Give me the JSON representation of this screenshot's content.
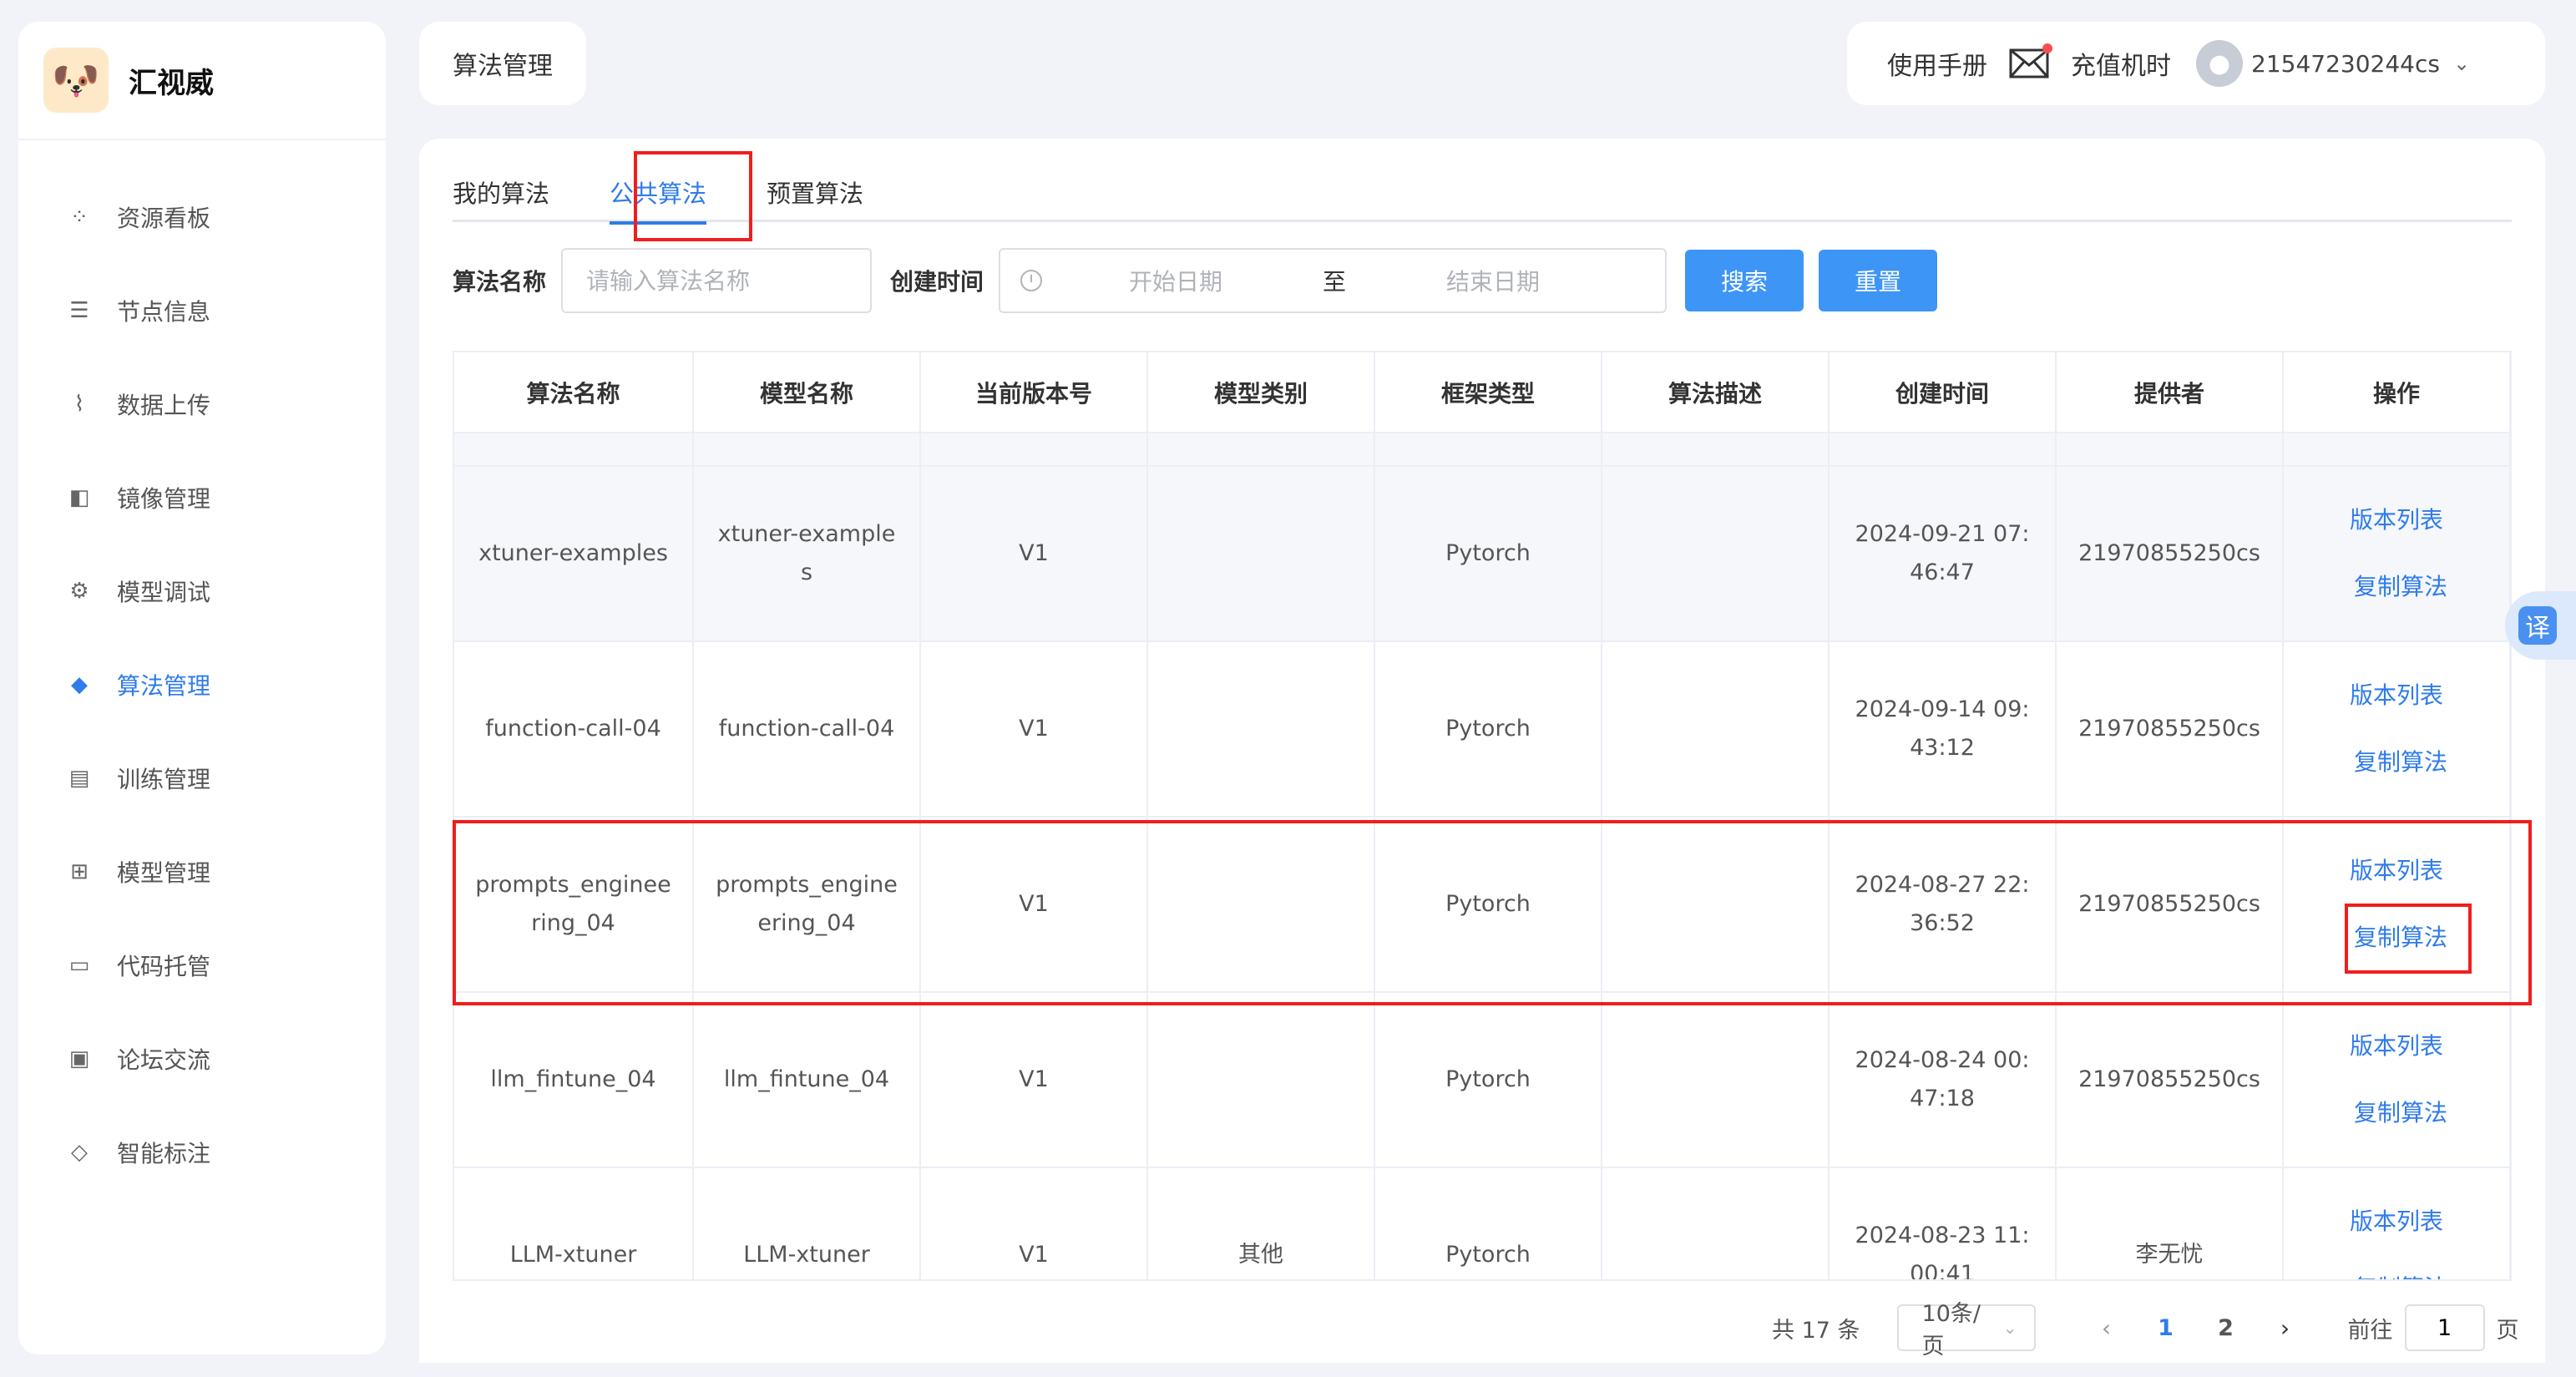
{
  "brand": {
    "name": "汇视威",
    "logo_icon": "dog-logo"
  },
  "sidebar": {
    "items": [
      {
        "label": "资源看板",
        "icon": "dashboard-icon"
      },
      {
        "label": "节点信息",
        "icon": "sliders-icon"
      },
      {
        "label": "数据上传",
        "icon": "chart-icon"
      },
      {
        "label": "镜像管理",
        "icon": "mirror-icon"
      },
      {
        "label": "模型调试",
        "icon": "gear-icon"
      },
      {
        "label": "算法管理",
        "icon": "cube-icon",
        "active": true
      },
      {
        "label": "训练管理",
        "icon": "list-icon"
      },
      {
        "label": "模型管理",
        "icon": "grid-icon"
      },
      {
        "label": "代码托管",
        "icon": "code-icon"
      },
      {
        "label": "论坛交流",
        "icon": "chat-icon"
      },
      {
        "label": "智能标注",
        "icon": "tag-icon"
      }
    ]
  },
  "header": {
    "page_title": "算法管理",
    "manual": "使用手册",
    "recharge": "充值机时",
    "username": "21547230244cs"
  },
  "tabs": [
    {
      "label": "我的算法"
    },
    {
      "label": "公共算法",
      "active": true
    },
    {
      "label": "预置算法"
    }
  ],
  "filters": {
    "name_label": "算法名称",
    "name_placeholder": "请输入算法名称",
    "time_label": "创建时间",
    "start_placeholder": "开始日期",
    "range_sep": "至",
    "end_placeholder": "结束日期",
    "search_btn": "搜索",
    "reset_btn": "重置"
  },
  "table": {
    "columns": [
      "算法名称",
      "模型名称",
      "当前版本号",
      "模型类别",
      "框架类型",
      "算法描述",
      "创建时间",
      "提供者",
      "操作"
    ],
    "op_versions": "版本列表",
    "op_copy": "复制算法",
    "rows": [
      [
        "xtuner-examples",
        "xtuner-examples",
        "V1",
        "",
        "Pytorch",
        "",
        "2024-09-21 07:46:47",
        "21970855250cs"
      ],
      [
        "function-call-04",
        "function-call-04",
        "V1",
        "",
        "Pytorch",
        "",
        "2024-09-14 09:43:12",
        "21970855250cs"
      ],
      [
        "prompts_engineering_04",
        "prompts_engineering_04",
        "V1",
        "",
        "Pytorch",
        "",
        "2024-08-27 22:36:52",
        "21970855250cs"
      ],
      [
        "llm_fintune_04",
        "llm_fintune_04",
        "V1",
        "",
        "Pytorch",
        "",
        "2024-08-24 00:47:18",
        "21970855250cs"
      ],
      [
        "LLM-xtuner",
        "LLM-xtuner",
        "V1",
        "其他",
        "Pytorch",
        "",
        "2024-08-23 11:00:41",
        "李无忧"
      ]
    ]
  },
  "pagination": {
    "total": "共 17 条",
    "page_size": "10条/页",
    "pages": [
      "1",
      "2"
    ],
    "current": "1",
    "goto_label": "前往",
    "goto_value": "1",
    "page_unit": "页"
  },
  "translate_btn": "译",
  "colors": {
    "accent": "#2f7bea",
    "button": "#3d95f5",
    "highlight": "#f01e1e"
  }
}
